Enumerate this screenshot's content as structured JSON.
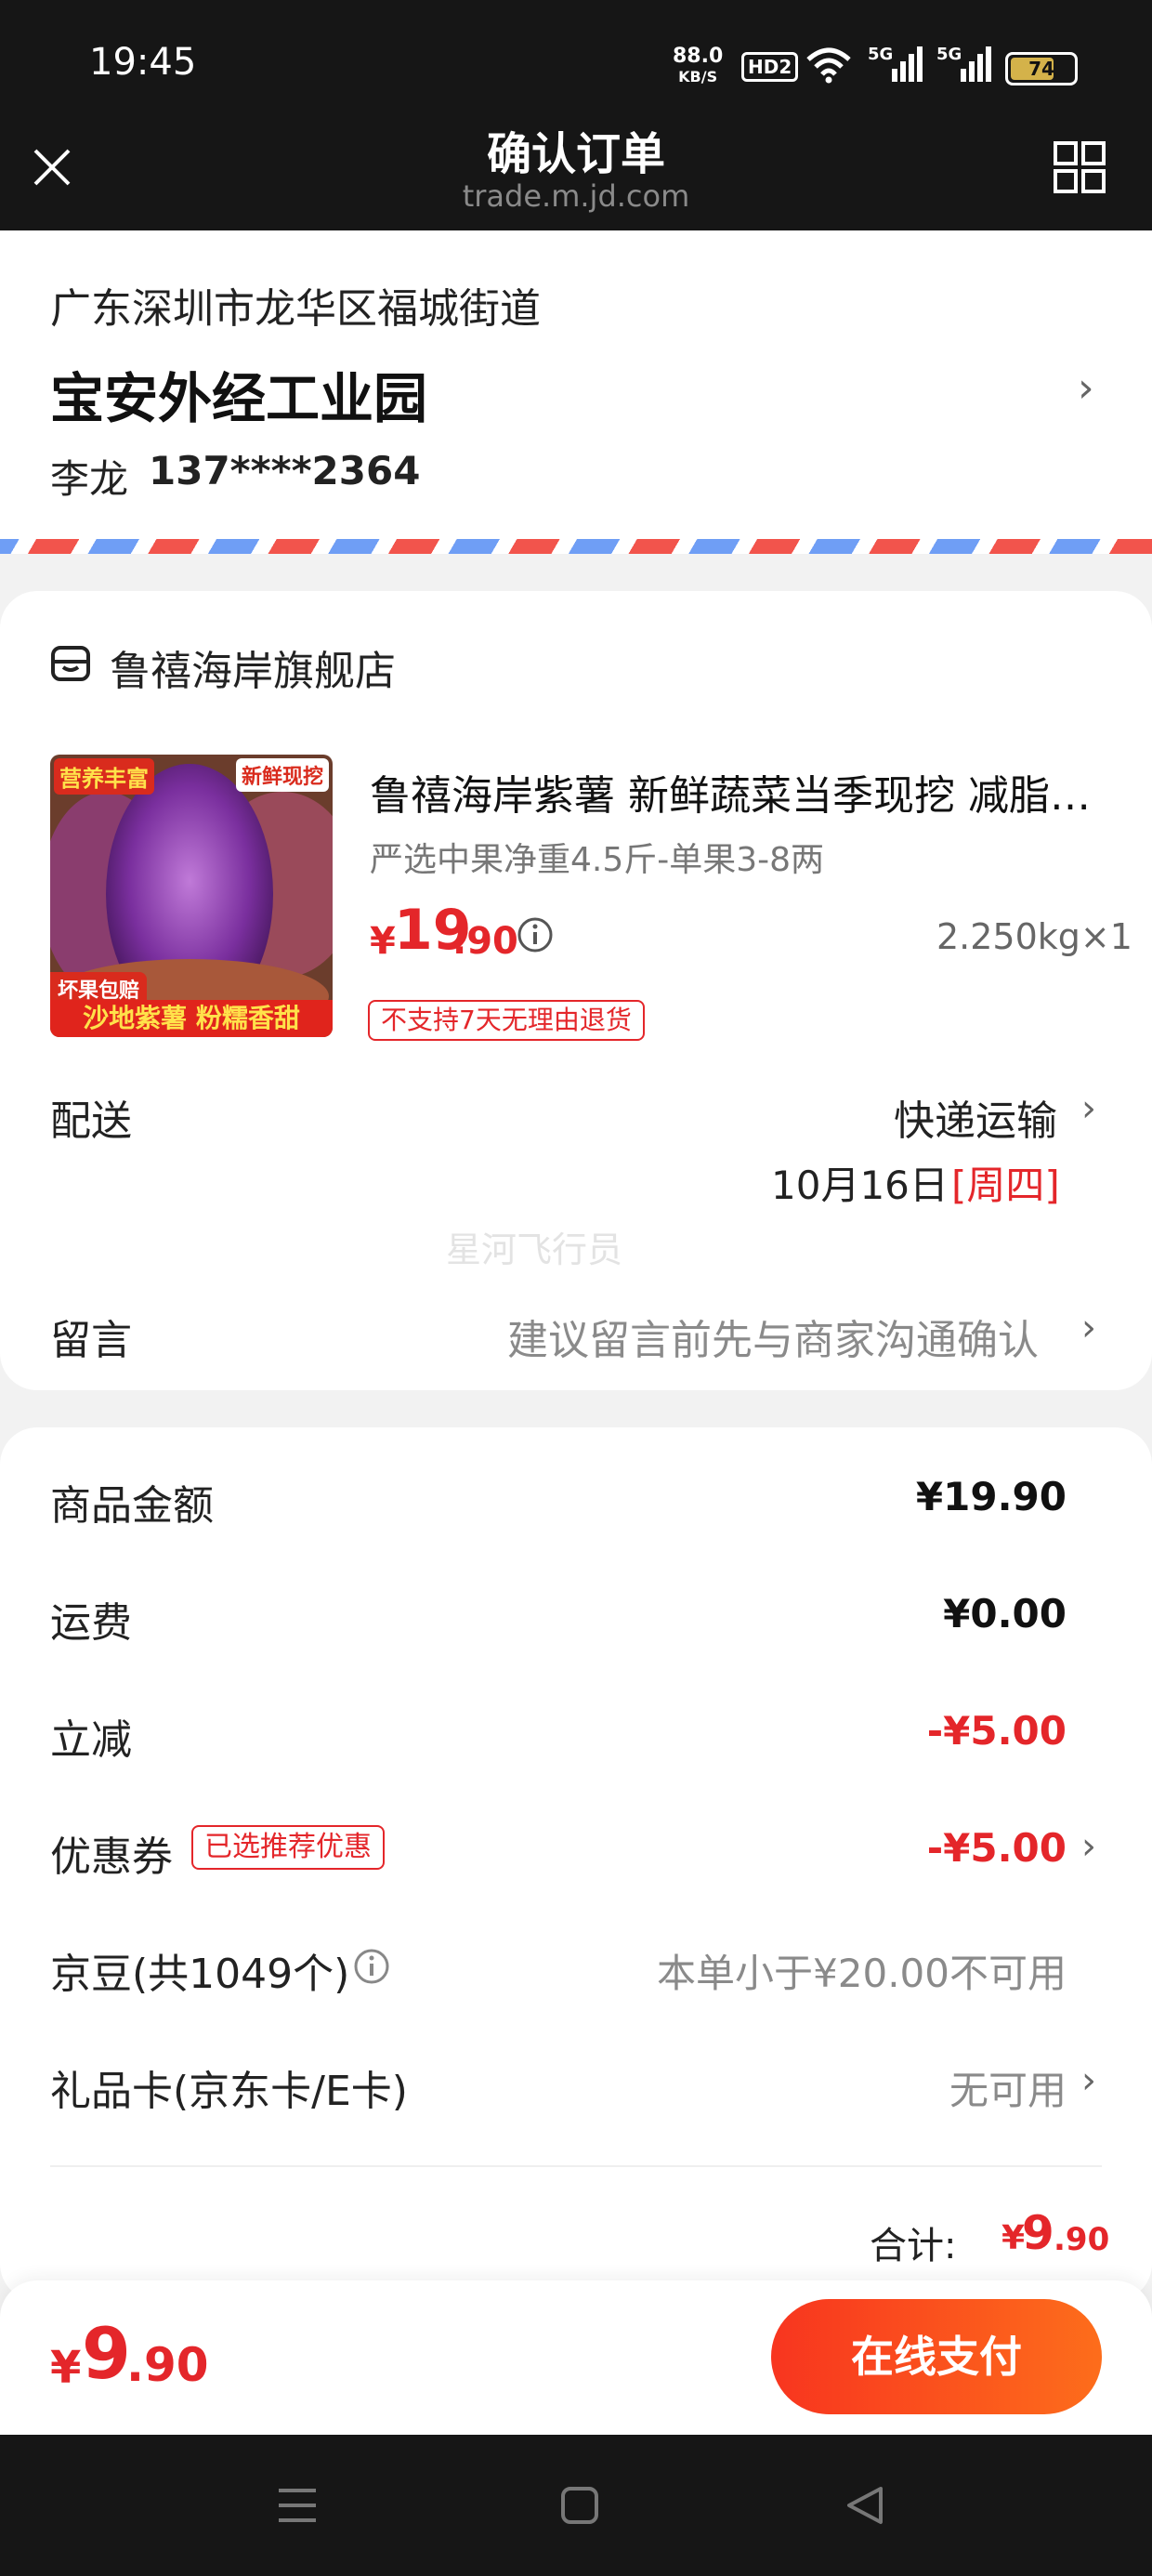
{
  "status_bar": {
    "time": "19:45",
    "net_speed_value": "88.0",
    "net_speed_unit": "KB/S",
    "hd_label": "HD2",
    "signal_labels": [
      "5G",
      "5G"
    ],
    "battery": "74"
  },
  "header": {
    "title": "确认订单",
    "domain": "trade.m.jd.com"
  },
  "address": {
    "line1": "广东深圳市龙华区福城街道",
    "line2": "宝安外经工业园",
    "name": "李龙",
    "phone": "137****2364"
  },
  "store": {
    "name": "鲁禧海岸旗舰店"
  },
  "product": {
    "title": "鲁禧海岸紫薯 新鲜蔬菜当季现挖 减脂代餐",
    "spec": "严选中果净重4.5斤-单果3-8两",
    "price_symbol": "¥",
    "price_int": "19",
    "price_dec": ".90",
    "quantity": "2.250kg×1",
    "return_policy": "不支持7天无理由退货",
    "image_tags": {
      "top_left": "营养丰富",
      "top_right": "新鲜现挖",
      "badge": "坏果包赔",
      "bottom": "沙地紫薯 粉糯香甜"
    }
  },
  "delivery": {
    "label": "配送",
    "method": "快递运输",
    "date": "10月16日",
    "weekday": "[周四]"
  },
  "watermark": "星河飞行员",
  "message": {
    "label": "留言",
    "placeholder": "建议留言前先与商家沟通确认"
  },
  "summary": {
    "goods_label": "商品金额",
    "goods_value": "¥19.90",
    "shipping_label": "运费",
    "shipping_value": "¥0.00",
    "discount_label": "立减",
    "discount_value": "-¥5.00",
    "coupon_label": "优惠券",
    "coupon_badge": "已选推荐优惠",
    "coupon_value": "-¥5.00",
    "jingdou_label": "京豆(共1049个)",
    "jingdou_value": "本单小于¥20.00不可用",
    "giftcard_label": "礼品卡(京东卡/E卡)",
    "giftcard_value": "无可用",
    "total_label": "合计:",
    "total_symbol": "¥",
    "total_int": "9",
    "total_dec": ".90"
  },
  "pay_bar": {
    "symbol": "¥",
    "amount_int": "9",
    "amount_dec": ".90",
    "button_label": "在线支付"
  },
  "colors": {
    "accent_red": "#e4262a",
    "pay_gradient_start": "#f8351f",
    "pay_gradient_end": "#fd6d1b",
    "header_bg": "#161616"
  }
}
